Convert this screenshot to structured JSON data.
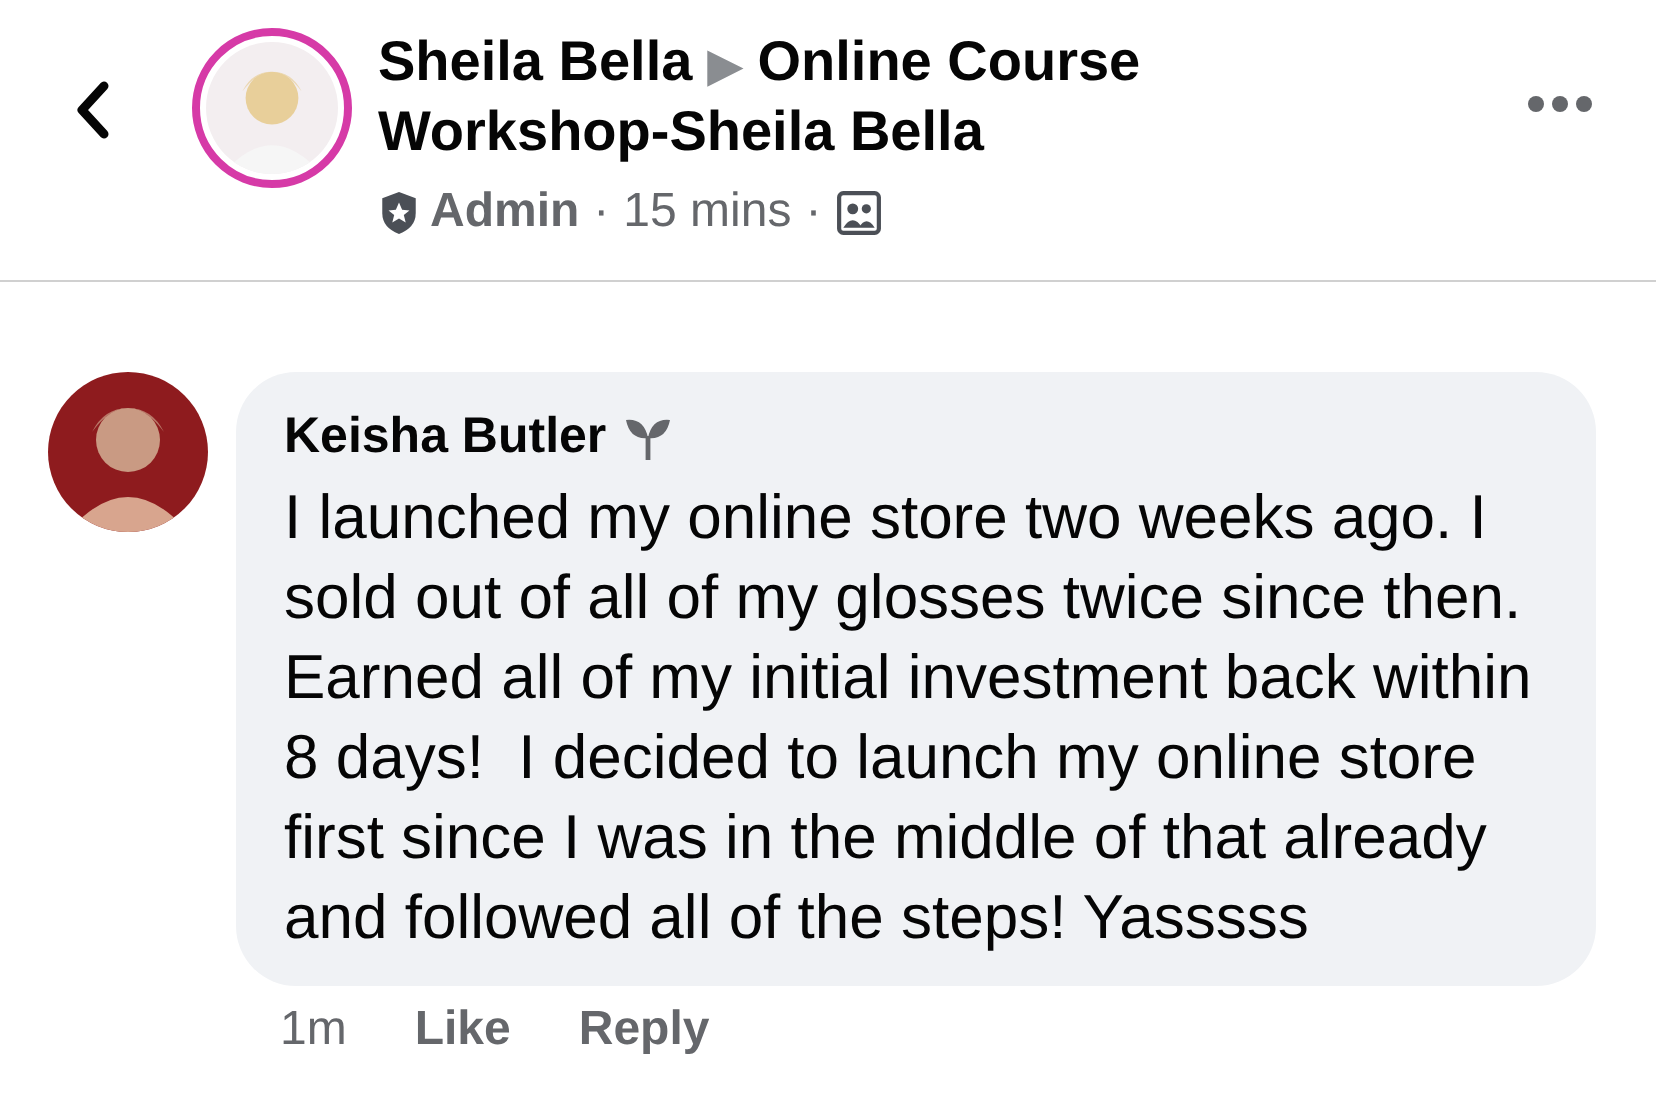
{
  "header": {
    "author": "Sheila Bella",
    "arrow": "▶",
    "group": "Online Course Workshop-Sheila Bella",
    "role": "Admin",
    "separator_1": "·",
    "time": "15 mins",
    "separator_2": "·"
  },
  "comment": {
    "author": "Keisha Butler",
    "text": "I launched my online store two weeks ago. I sold out of all of my glosses twice since then. Earned all of my initial investment back within 8 days!  I decided to launch my online store first since I was in the middle of that already and followed all of the steps! Yasssss",
    "time": "1m",
    "actions": [
      "Like",
      "Reply"
    ]
  }
}
